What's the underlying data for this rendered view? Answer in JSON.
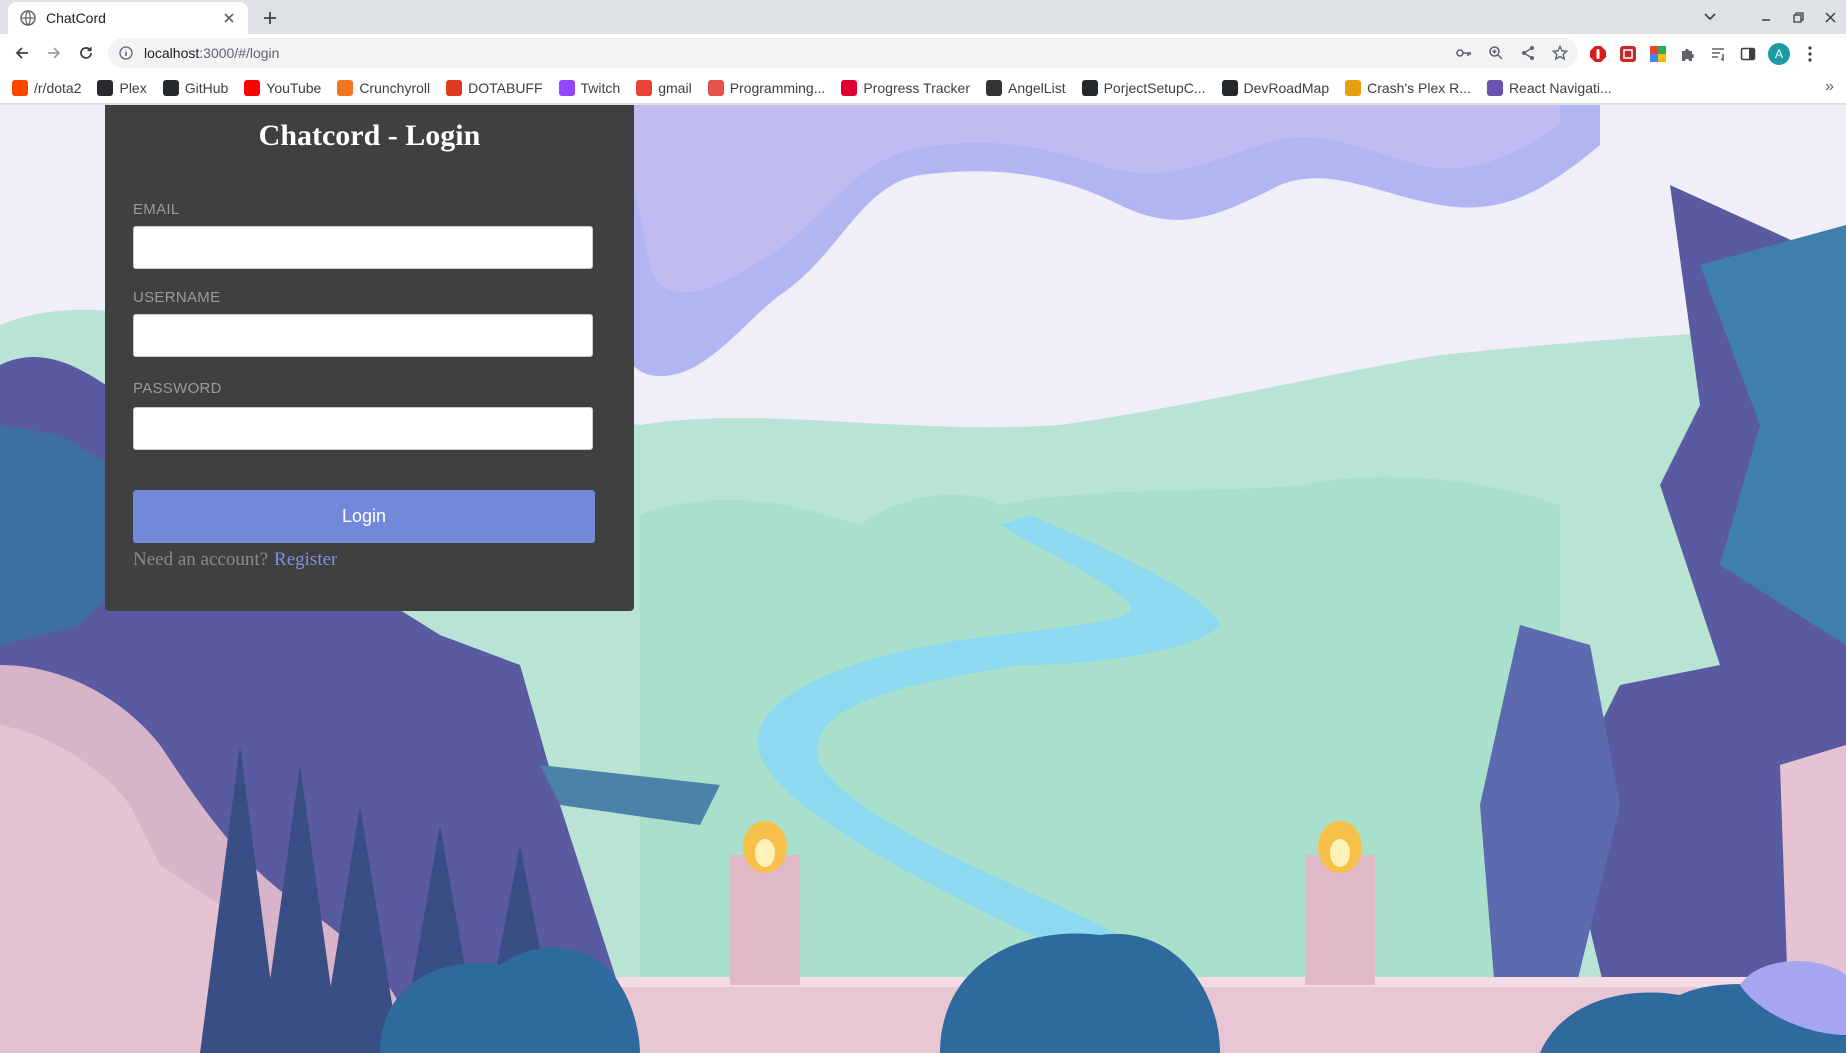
{
  "browser": {
    "tab_title": "ChatCord",
    "url_host": "localhost",
    "url_path": ":3000/#/login",
    "avatar_letter": "A"
  },
  "bookmarks": [
    {
      "label": "/r/dota2",
      "icon": "reddit-icon",
      "color": "#ff4500"
    },
    {
      "label": "Plex",
      "icon": "plex-icon",
      "color": "#282a2d"
    },
    {
      "label": "GitHub",
      "icon": "github-icon",
      "color": "#24292e"
    },
    {
      "label": "YouTube",
      "icon": "youtube-icon",
      "color": "#ff0000"
    },
    {
      "label": "Crunchyroll",
      "icon": "crunchyroll-icon",
      "color": "#f47521"
    },
    {
      "label": "DOTABUFF",
      "icon": "dotabuff-icon",
      "color": "#e03a21"
    },
    {
      "label": "Twitch",
      "icon": "twitch-icon",
      "color": "#9146ff"
    },
    {
      "label": "gmail",
      "icon": "gmail-icon",
      "color": "#ea4335"
    },
    {
      "label": "Programming...",
      "icon": "programming-icon",
      "color": "#e5534b"
    },
    {
      "label": "Progress Tracker",
      "icon": "angular-icon",
      "color": "#dd0031"
    },
    {
      "label": "AngelList",
      "icon": "angellist-icon",
      "color": "#333333"
    },
    {
      "label": "PorjectSetupC...",
      "icon": "github-icon",
      "color": "#24292e"
    },
    {
      "label": "DevRoadMap",
      "icon": "github-icon",
      "color": "#24292e"
    },
    {
      "label": "Crash's Plex R...",
      "icon": "plex-request-icon",
      "color": "#e5a00d"
    },
    {
      "label": "React Navigati...",
      "icon": "react-navigation-icon",
      "color": "#6b52ae"
    }
  ],
  "login": {
    "title": "Chatcord - Login",
    "email_label": "EMAIL",
    "email_value": "",
    "username_label": "USERNAME",
    "username_value": "",
    "password_label": "PASSWORD",
    "password_value": "",
    "button_label": "Login",
    "need_account_text": "Need an account?",
    "register_link": "Register"
  },
  "colors": {
    "card_bg": "#404040",
    "button_bg": "#7289da",
    "link": "#7d91e0"
  }
}
